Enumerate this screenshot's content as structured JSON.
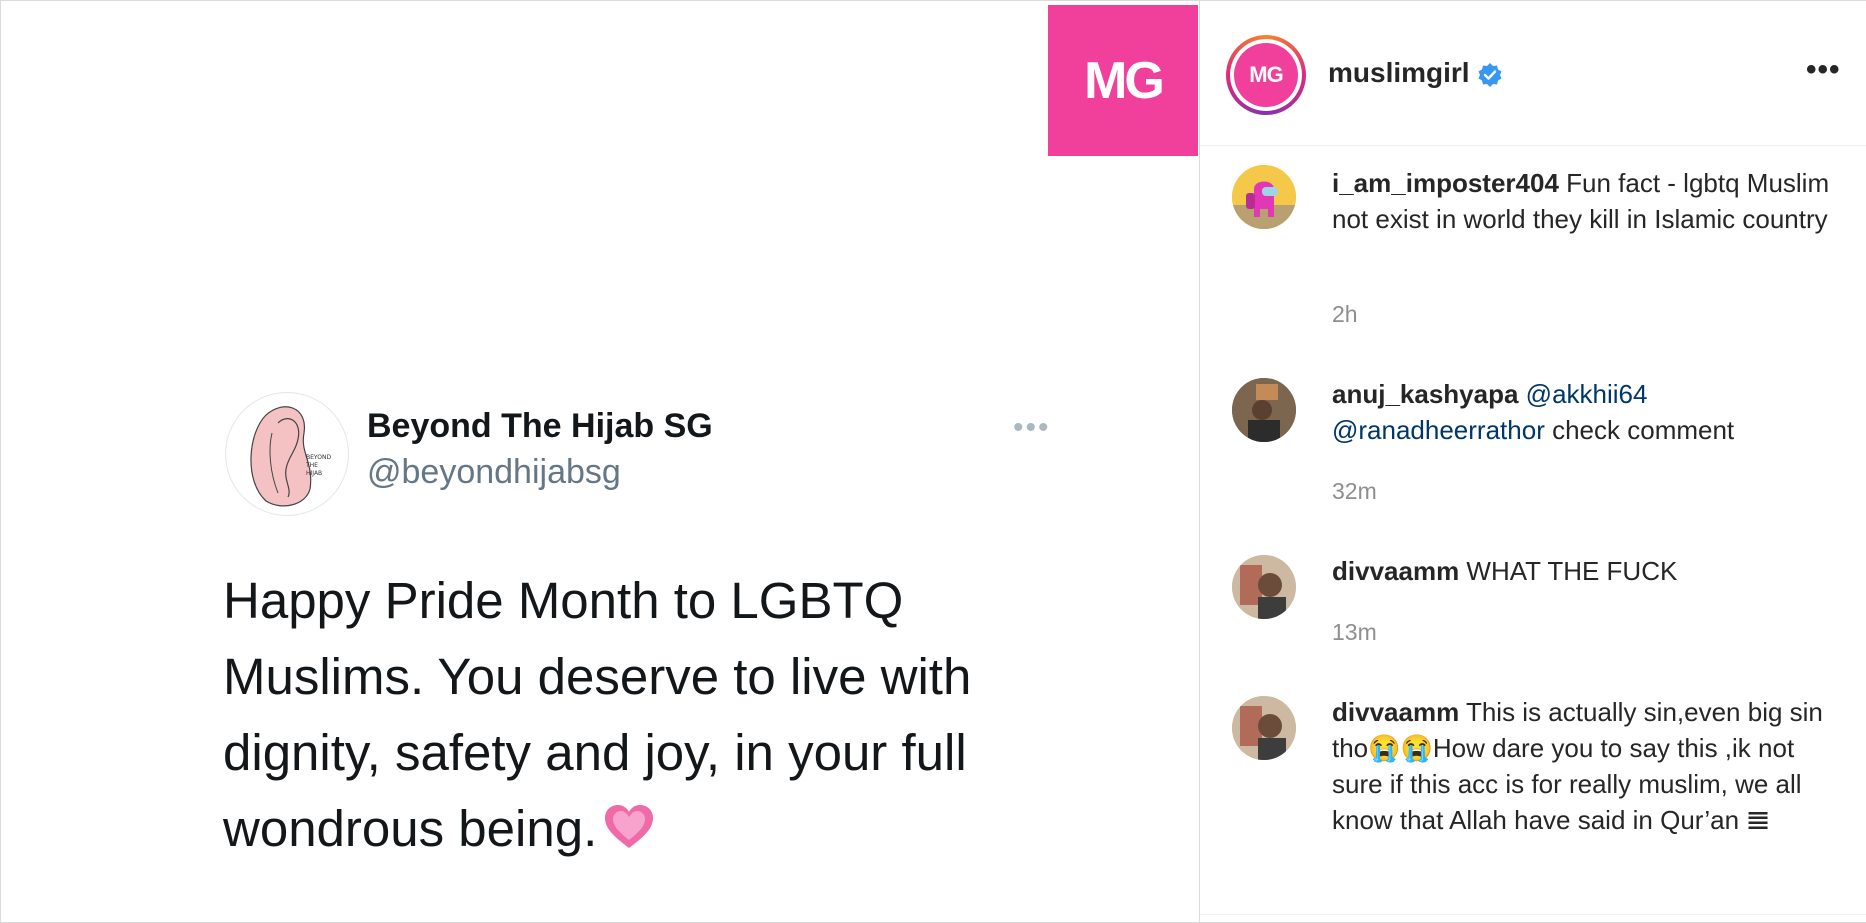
{
  "post_image": {
    "badge": "MG",
    "tweet": {
      "name": "Beyond The Hijab SG",
      "handle": "@beyondhijabsg",
      "text": "Happy Pride Month to LGBTQ Muslims. You deserve to live with dignity, safety and joy, in your full wondrous being.",
      "more": "•••",
      "avatar_logo_text": "BEYOND THE HIJAB"
    }
  },
  "header": {
    "avatar_text": "MG",
    "username": "muslimgirl",
    "more": "•••"
  },
  "comments": [
    {
      "user": "i_am_imposter404",
      "text": "Fun fact - lgbtq Muslim not exist in world they kill in Islamic country",
      "time": "2h"
    },
    {
      "user": "anuj_kashyapa",
      "mention1": "@akkhii64",
      "mention2": "@ranadheerrathor",
      "text": "check comment",
      "time": "32m"
    },
    {
      "user": "divvaamm",
      "text": "WHAT THE FUCK",
      "time": "13m"
    },
    {
      "user": "divvaamm",
      "text": "This is actually sin,even big sin tho😭😭How dare you to say this ,ik not sure if this acc is for really muslim, we all know that Allah have said in Qur’an 𝌆"
    }
  ],
  "colors": {
    "brand_pink": "#f1409c",
    "mention": "#00376b",
    "verified": "#3897f0"
  }
}
